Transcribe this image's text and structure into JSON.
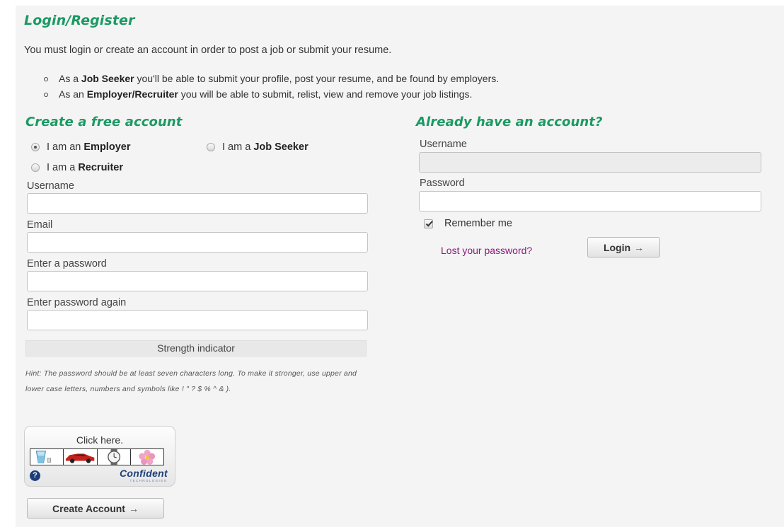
{
  "page": {
    "title": "Login/Register",
    "intro": "You must login or create an account in order to post a job or submit your resume.",
    "bullets": [
      {
        "pre": "As a ",
        "bold": "Job Seeker",
        "post": " you'll be able to submit your profile, post your resume, and be found by employers."
      },
      {
        "pre": "As an ",
        "bold": "Employer/Recruiter",
        "post": " you will be able to submit, relist, view and remove your job listings."
      }
    ]
  },
  "register": {
    "heading": "Create a free account",
    "roles": [
      {
        "pre": "I am an ",
        "bold": "Employer",
        "selected": true
      },
      {
        "pre": "I am a ",
        "bold": "Job Seeker",
        "selected": false
      },
      {
        "pre": "I am a ",
        "bold": "Recruiter",
        "selected": false
      }
    ],
    "username_label": "Username",
    "username_value": "",
    "email_label": "Email",
    "email_value": "",
    "password_label": "Enter a password",
    "password_value": "",
    "password_again_label": "Enter password again",
    "password_again_value": "",
    "strength_indicator": "Strength indicator",
    "hint": "Hint: The password should be at least seven characters long. To make it stronger, use upper and lower case letters, numbers and symbols like ! \" ? $ % ^ & ).",
    "captcha": {
      "label": "Click here.",
      "tiles": [
        "glass-icon",
        "car-icon",
        "watch-icon",
        "flower-icon"
      ],
      "help": "?",
      "brand": "Confident",
      "brand_sub": "TECHNOLOGIES"
    },
    "create_button": "Create Account",
    "button_arrow": "→"
  },
  "login": {
    "heading": "Already have an account?",
    "username_label": "Username",
    "username_value": "",
    "password_label": "Password",
    "password_value": "",
    "remember_label": "Remember me",
    "remember_checked": true,
    "lost_password": "Lost your password?",
    "login_button": "Login",
    "button_arrow": "→"
  },
  "colors": {
    "heading": "#1a9a62",
    "link": "#8b1a7e",
    "captcha_brand": "#1c3f7a"
  }
}
